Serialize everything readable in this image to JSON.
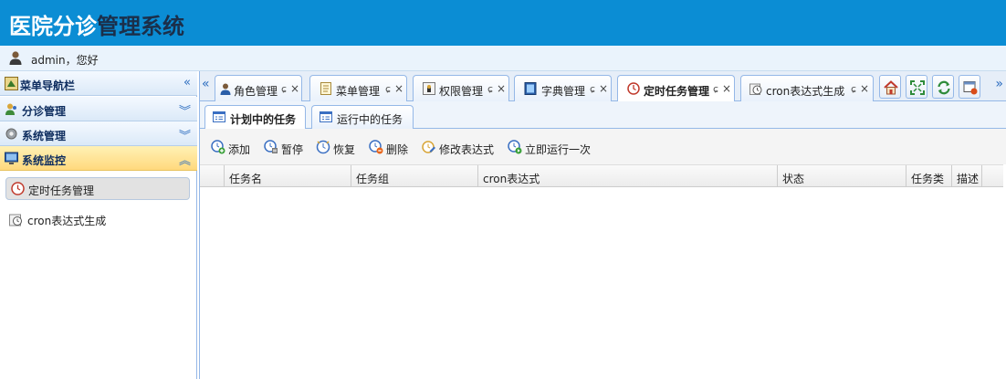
{
  "header": {
    "title_part1": "医院分诊",
    "title_part2": "管理系统"
  },
  "userbar": {
    "greeting": "admin，您好"
  },
  "sidebar": {
    "title": "菜单导航栏",
    "groups": [
      {
        "label": "分诊管理"
      },
      {
        "label": "系统管理"
      },
      {
        "label": "系统监控"
      }
    ],
    "items": [
      {
        "label": "定时任务管理"
      },
      {
        "label": "cron表达式生成"
      }
    ]
  },
  "tabs": [
    {
      "label": "角色管理"
    },
    {
      "label": "菜单管理"
    },
    {
      "label": "权限管理"
    },
    {
      "label": "字典管理"
    },
    {
      "label": "定时任务管理"
    },
    {
      "label": "cron表达式生成"
    }
  ],
  "tab_refresh_glyph": "ɕ",
  "tab_close_glyph": "×",
  "subtabs": [
    {
      "label": "计划中的任务"
    },
    {
      "label": "运行中的任务"
    }
  ],
  "actions": [
    {
      "label": "添加"
    },
    {
      "label": "暂停"
    },
    {
      "label": "恢复"
    },
    {
      "label": "删除"
    },
    {
      "label": "修改表达式"
    },
    {
      "label": "立即运行一次"
    }
  ],
  "grid": {
    "columns": [
      "任务名",
      "任务组",
      "cron表达式",
      "状态",
      "任务类",
      "描述"
    ]
  },
  "colors": {
    "header_bg": "#0b8dd4",
    "title_dark": "#1b2f4a",
    "active_group": "#ffd97d",
    "border": "#95b8e7"
  }
}
